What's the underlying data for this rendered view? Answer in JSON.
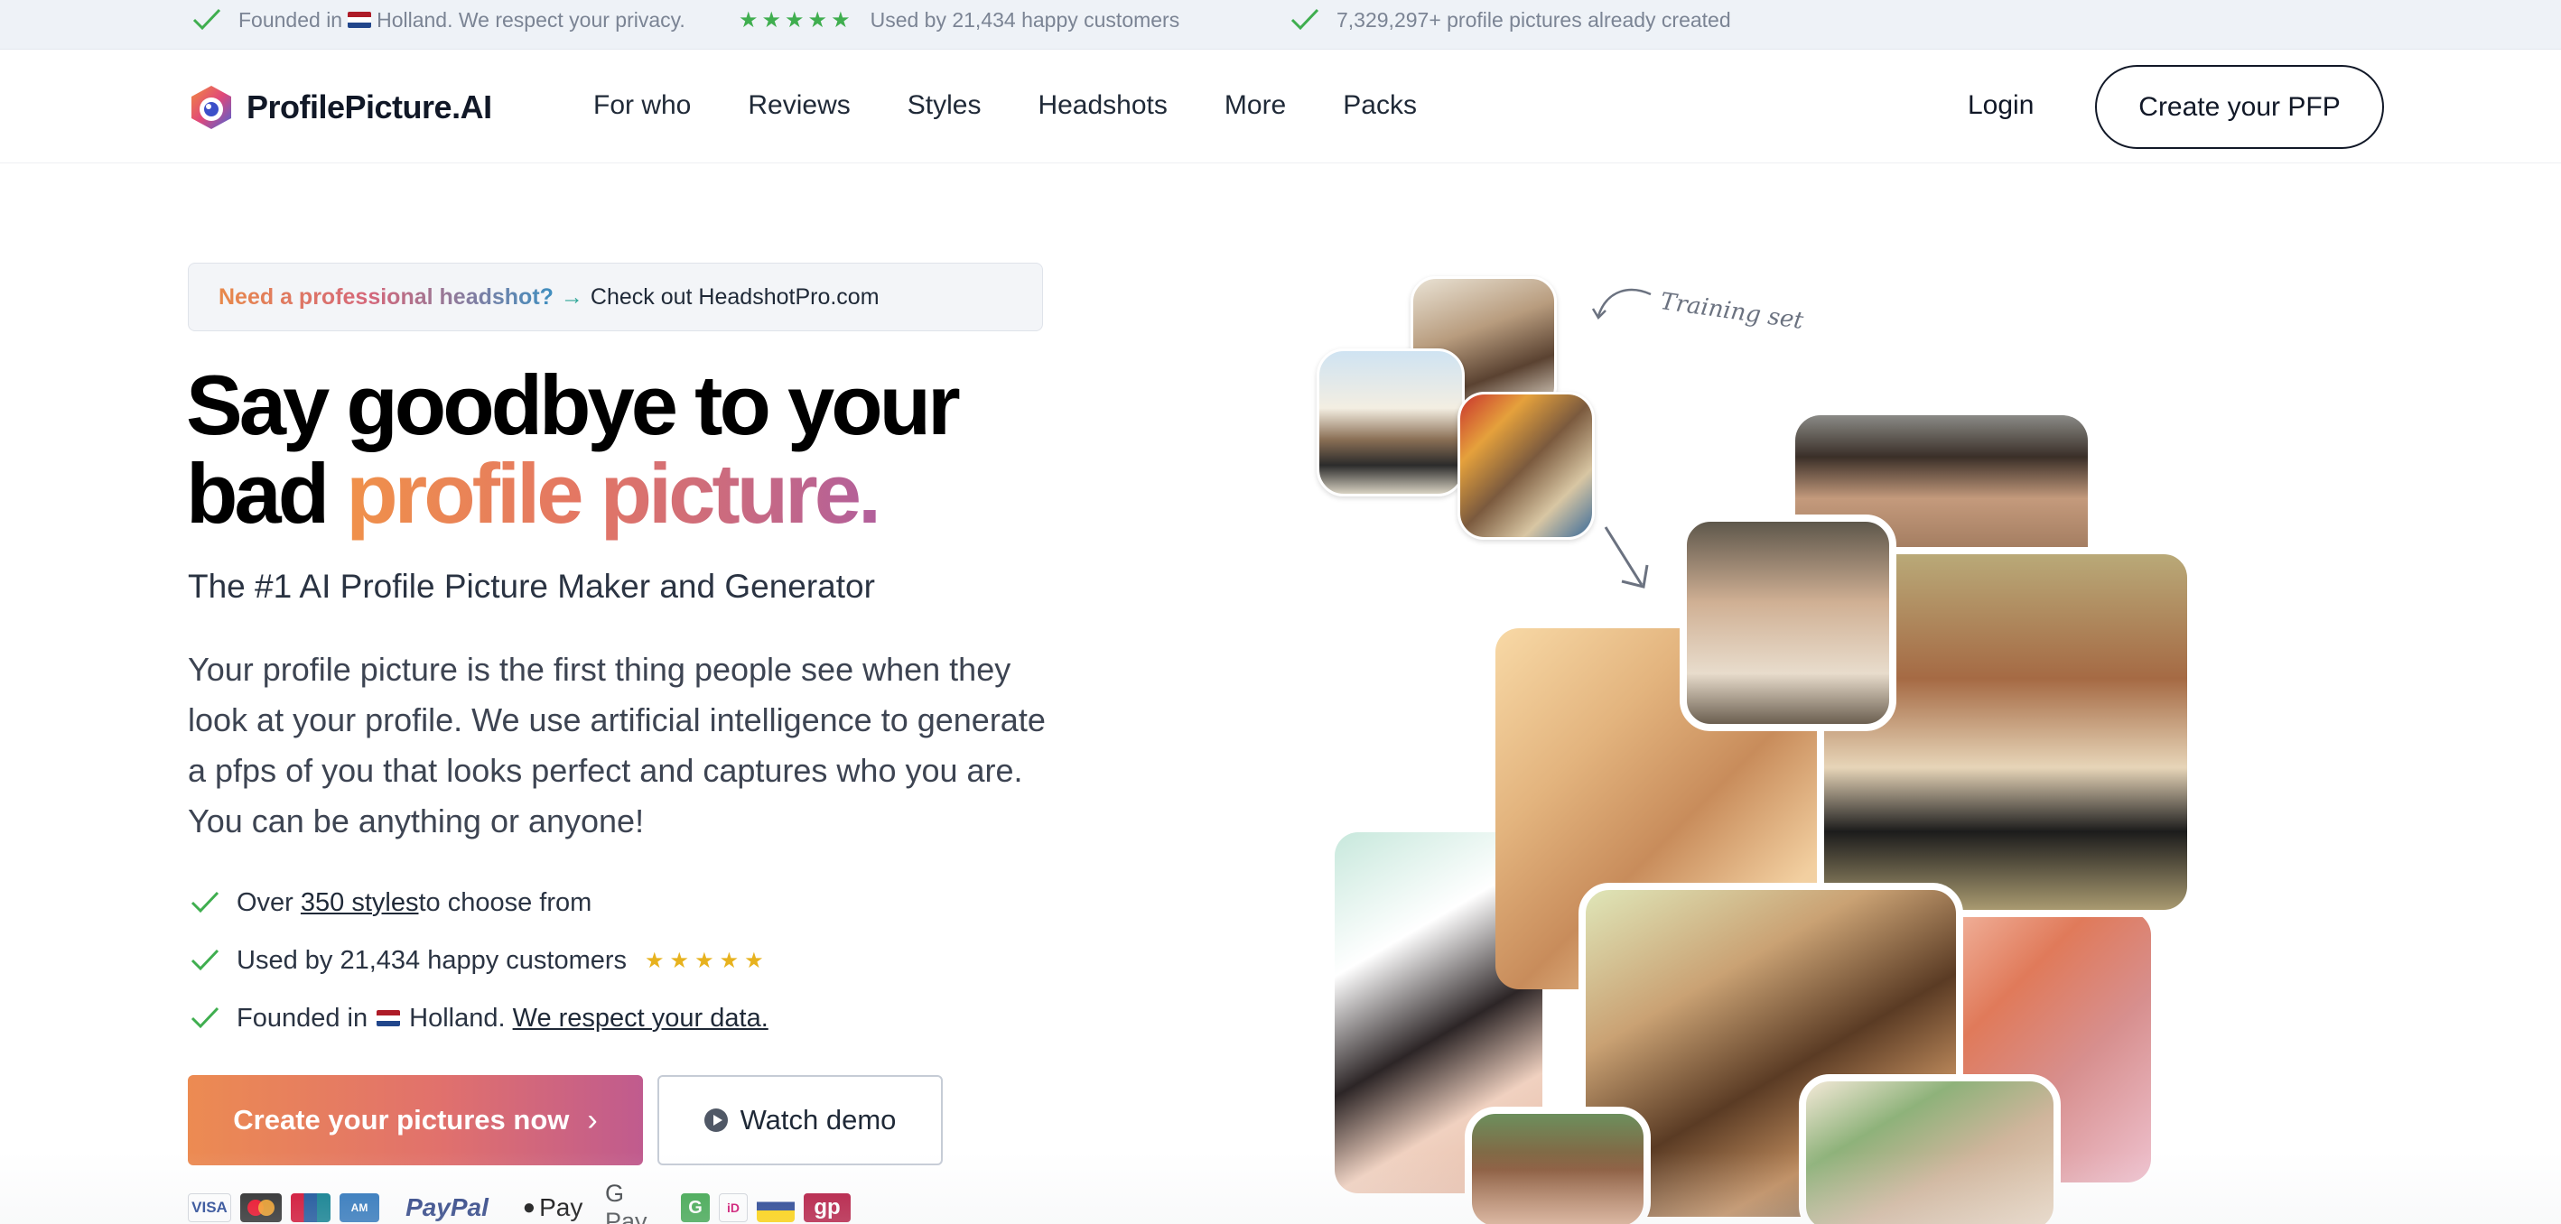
{
  "topbar": {
    "items": [
      {
        "pre": "Founded in",
        "post": "Holland. We respect your privacy."
      },
      {
        "stars": "★★★★★",
        "text": "Used by 21,434 happy customers"
      },
      {
        "text": "7,329,297+ profile pictures already created"
      }
    ]
  },
  "header": {
    "logo_text": "ProfilePicture.AI",
    "nav": [
      "For who",
      "Reviews",
      "Styles",
      "Headshots",
      "More",
      "Packs"
    ],
    "login_label": "Login",
    "cta_label": "Create your PFP"
  },
  "promo": {
    "highlight": "Need a professional headshot?",
    "arrow": "→",
    "rest": "Check out HeadshotPro.com"
  },
  "hero": {
    "title_line1": "Say goodbye to your",
    "title_line2_plain": "bad ",
    "title_line2_accent": "profile picture.",
    "subtitle": "The #1 AI Profile Picture Maker and Generator",
    "description": "Your profile picture is the first thing people see when they look at your profile. We use artificial intelligence to generate a pfps of you that looks perfect and captures who you are. You can be anything or anyone!",
    "bullets": {
      "b1_pre": "Over ",
      "b1_link": "350 styles ",
      "b1_post": "to choose from",
      "b2_text": "Used by 21,434 happy customers",
      "b2_stars": "★★★★★",
      "b3_pre": "Founded in",
      "b3_mid": "Holland.",
      "b3_link": "We respect your data."
    },
    "primary_button": "Create your pictures now",
    "primary_chevron": "›",
    "secondary_button": "Watch demo"
  },
  "payments": [
    "VISA",
    "PayPal",
    "Pay",
    "G Pay",
    "G",
    "gp"
  ],
  "collage": {
    "note": "Training set"
  },
  "colors": {
    "accent_start": "#f0914a",
    "accent_end": "#b25f9b",
    "check_green": "#3fae4f",
    "star_gold": "#e7b21e"
  }
}
